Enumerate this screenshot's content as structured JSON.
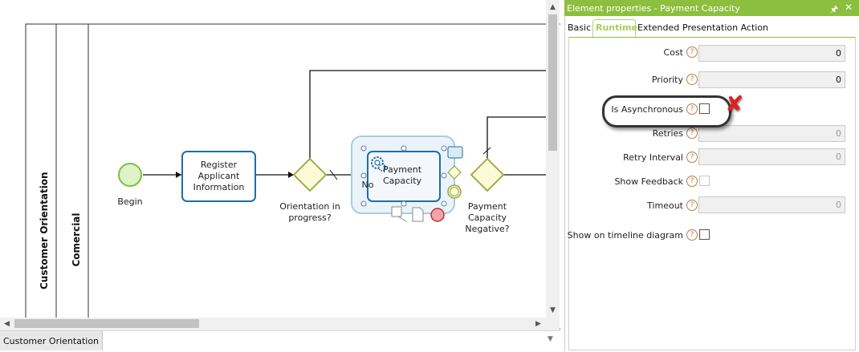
{
  "diagram": {
    "pool_label": "Customer Orientation",
    "lane_label": "Comercial",
    "start_event_label": "Begin",
    "task1_label_lines": [
      "Register",
      "Applicant",
      "Information"
    ],
    "gateway1_label_lines": [
      "Orientation in",
      "progress?"
    ],
    "task2_label_lines": [
      "Payment",
      "Capacity"
    ],
    "flow_label_no": "No",
    "gateway2_label_lines": [
      "Payment",
      "Capacity",
      "Negative?"
    ],
    "colors": {
      "start_event": "#78c23c",
      "task_border": "#1f6ea5",
      "gateway": "#9aa53a",
      "end_event": "#d9404a"
    }
  },
  "tabs": {
    "diagram_tab_label": "Customer Orientation"
  },
  "panel": {
    "title": "Element properties - Payment Capacity",
    "tabs": [
      "Basic",
      "Runtime",
      "Extended",
      "Presentation Action"
    ],
    "active_tab": "Runtime",
    "accent_color": "#8cbf3f",
    "help_glyph": "?",
    "fields": {
      "cost": {
        "label": "Cost",
        "value": "0"
      },
      "priority": {
        "label": "Priority",
        "value": "0"
      },
      "is_async": {
        "label": "Is Asynchronous",
        "checked": false
      },
      "retries": {
        "label": "Retries",
        "value": "0"
      },
      "retry_interval": {
        "label": "Retry Interval",
        "value": "0"
      },
      "show_feedback": {
        "label": "Show Feedback",
        "checked": false
      },
      "timeout": {
        "label": "Timeout",
        "value": "0"
      },
      "show_timeline": {
        "label": "Show on timeline diagram",
        "checked": false
      }
    }
  },
  "annotation": {
    "highlight_icon": "red-x-icon",
    "highlight_glyph": "✘"
  }
}
